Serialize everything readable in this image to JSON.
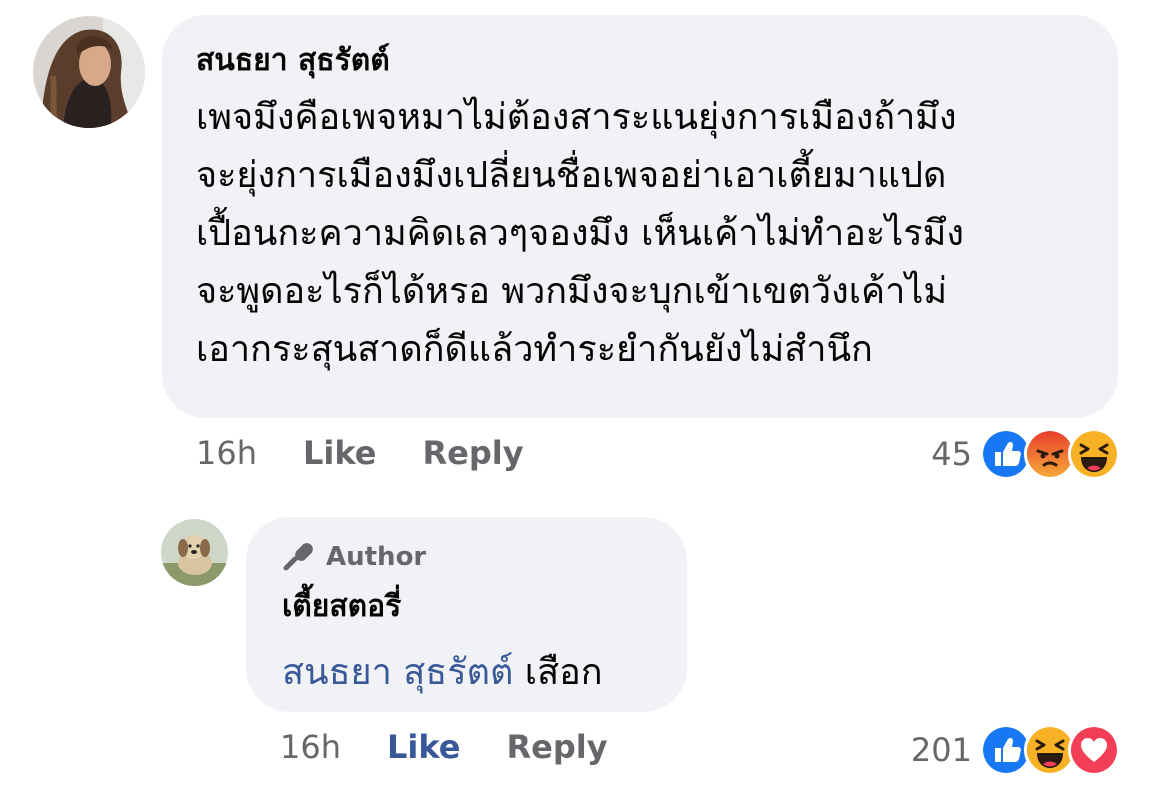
{
  "comment": {
    "author": "สนธยา สุธรัตต์",
    "lines": [
      "เพจมึงคือเพจหมาไม่ต้องสาระแนยุ่งการเมืองถ้ามึง",
      "จะยุ่งการเมืองมึงเปลี่ยนชื่อเพจอย่าเอาเตี้ยมาแปด",
      "เปื้อนกะความคิดเลวๆจองมึง เห็นเค้าไม่ทำอะไรมึง",
      "จะพูดอะไรก็ได้หรอ พวกมึงจะบุกเข้าเขตวังเค้าไม่",
      "เอากระสุนสาดก็ดีแล้วทำระยำกันยังไม่สำนึก"
    ],
    "time": "16h",
    "like_label": "Like",
    "reply_label": "Reply",
    "reaction_count": "45",
    "reactions": [
      "like-icon",
      "angry-icon",
      "haha-icon"
    ]
  },
  "reply": {
    "badge": "Author",
    "author": "เตี้ยสตอรี่",
    "mention": "สนธยา สุธรัตต์",
    "text": " เสือก",
    "time": "16h",
    "like_label": "Like",
    "reply_label": "Reply",
    "reaction_count": "201",
    "reactions": [
      "like-icon",
      "haha-icon",
      "love-icon"
    ],
    "liked": true
  },
  "colors": {
    "bubble": "#f0f2f5",
    "link": "#385898",
    "muted": "#65676b",
    "like": "#1877f2",
    "angry": "#e9710f",
    "haha": "#f7b125",
    "love": "#f33e58"
  }
}
